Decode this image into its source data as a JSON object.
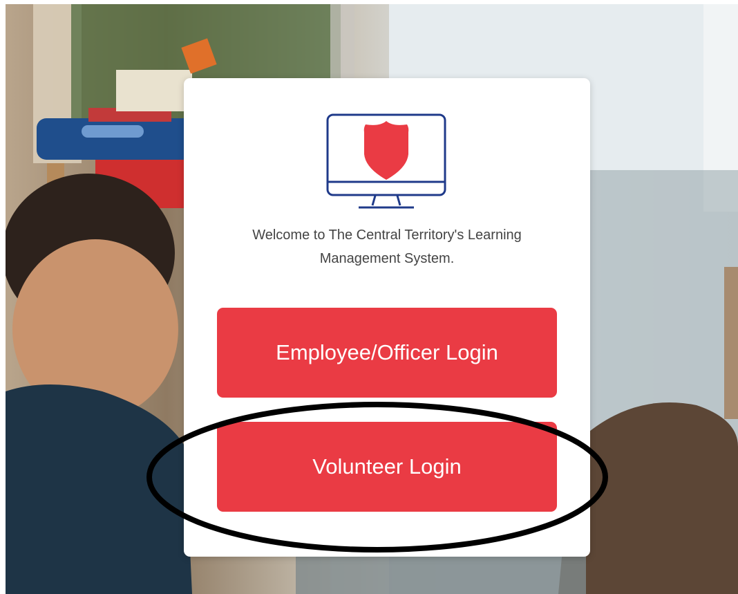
{
  "colors": {
    "brand_red": "#ea3b44",
    "logo_blue": "#1f3a8a",
    "text_gray": "#444444",
    "annotation": "#000000"
  },
  "icons": {
    "logo": "computer-monitor-shield-icon"
  },
  "login": {
    "welcome_text": "Welcome to The Central Territory's Learning Management System.",
    "employee_button": "Employee/Officer Login",
    "volunteer_button": "Volunteer Login"
  }
}
